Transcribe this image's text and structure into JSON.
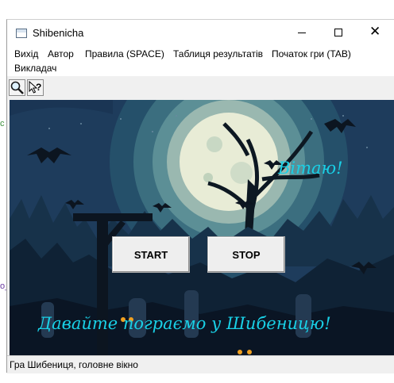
{
  "window": {
    "title": "Shibenicha"
  },
  "menu": [
    {
      "label": "Вихід"
    },
    {
      "label": "Автор"
    },
    {
      "label": "Правила  (SPACE)"
    },
    {
      "label": "Таблиця результатів"
    },
    {
      "label": "Початок гри  (TAB)"
    },
    {
      "label": "Викладач"
    }
  ],
  "toolbar": {
    "tools": [
      "magnifier-icon",
      "help-pointer-icon"
    ]
  },
  "scene": {
    "greeting": "Вітаю!",
    "start_label": "START",
    "stop_label": "STOP",
    "banner": "Давайте пограємо у Шибеницю!"
  },
  "statusbar": {
    "text": "Гра Шибениця, головне вікно"
  },
  "colors": {
    "accent_text": "#19d0e6",
    "moon": "#e8ecd6",
    "sky": "#2a5670"
  }
}
